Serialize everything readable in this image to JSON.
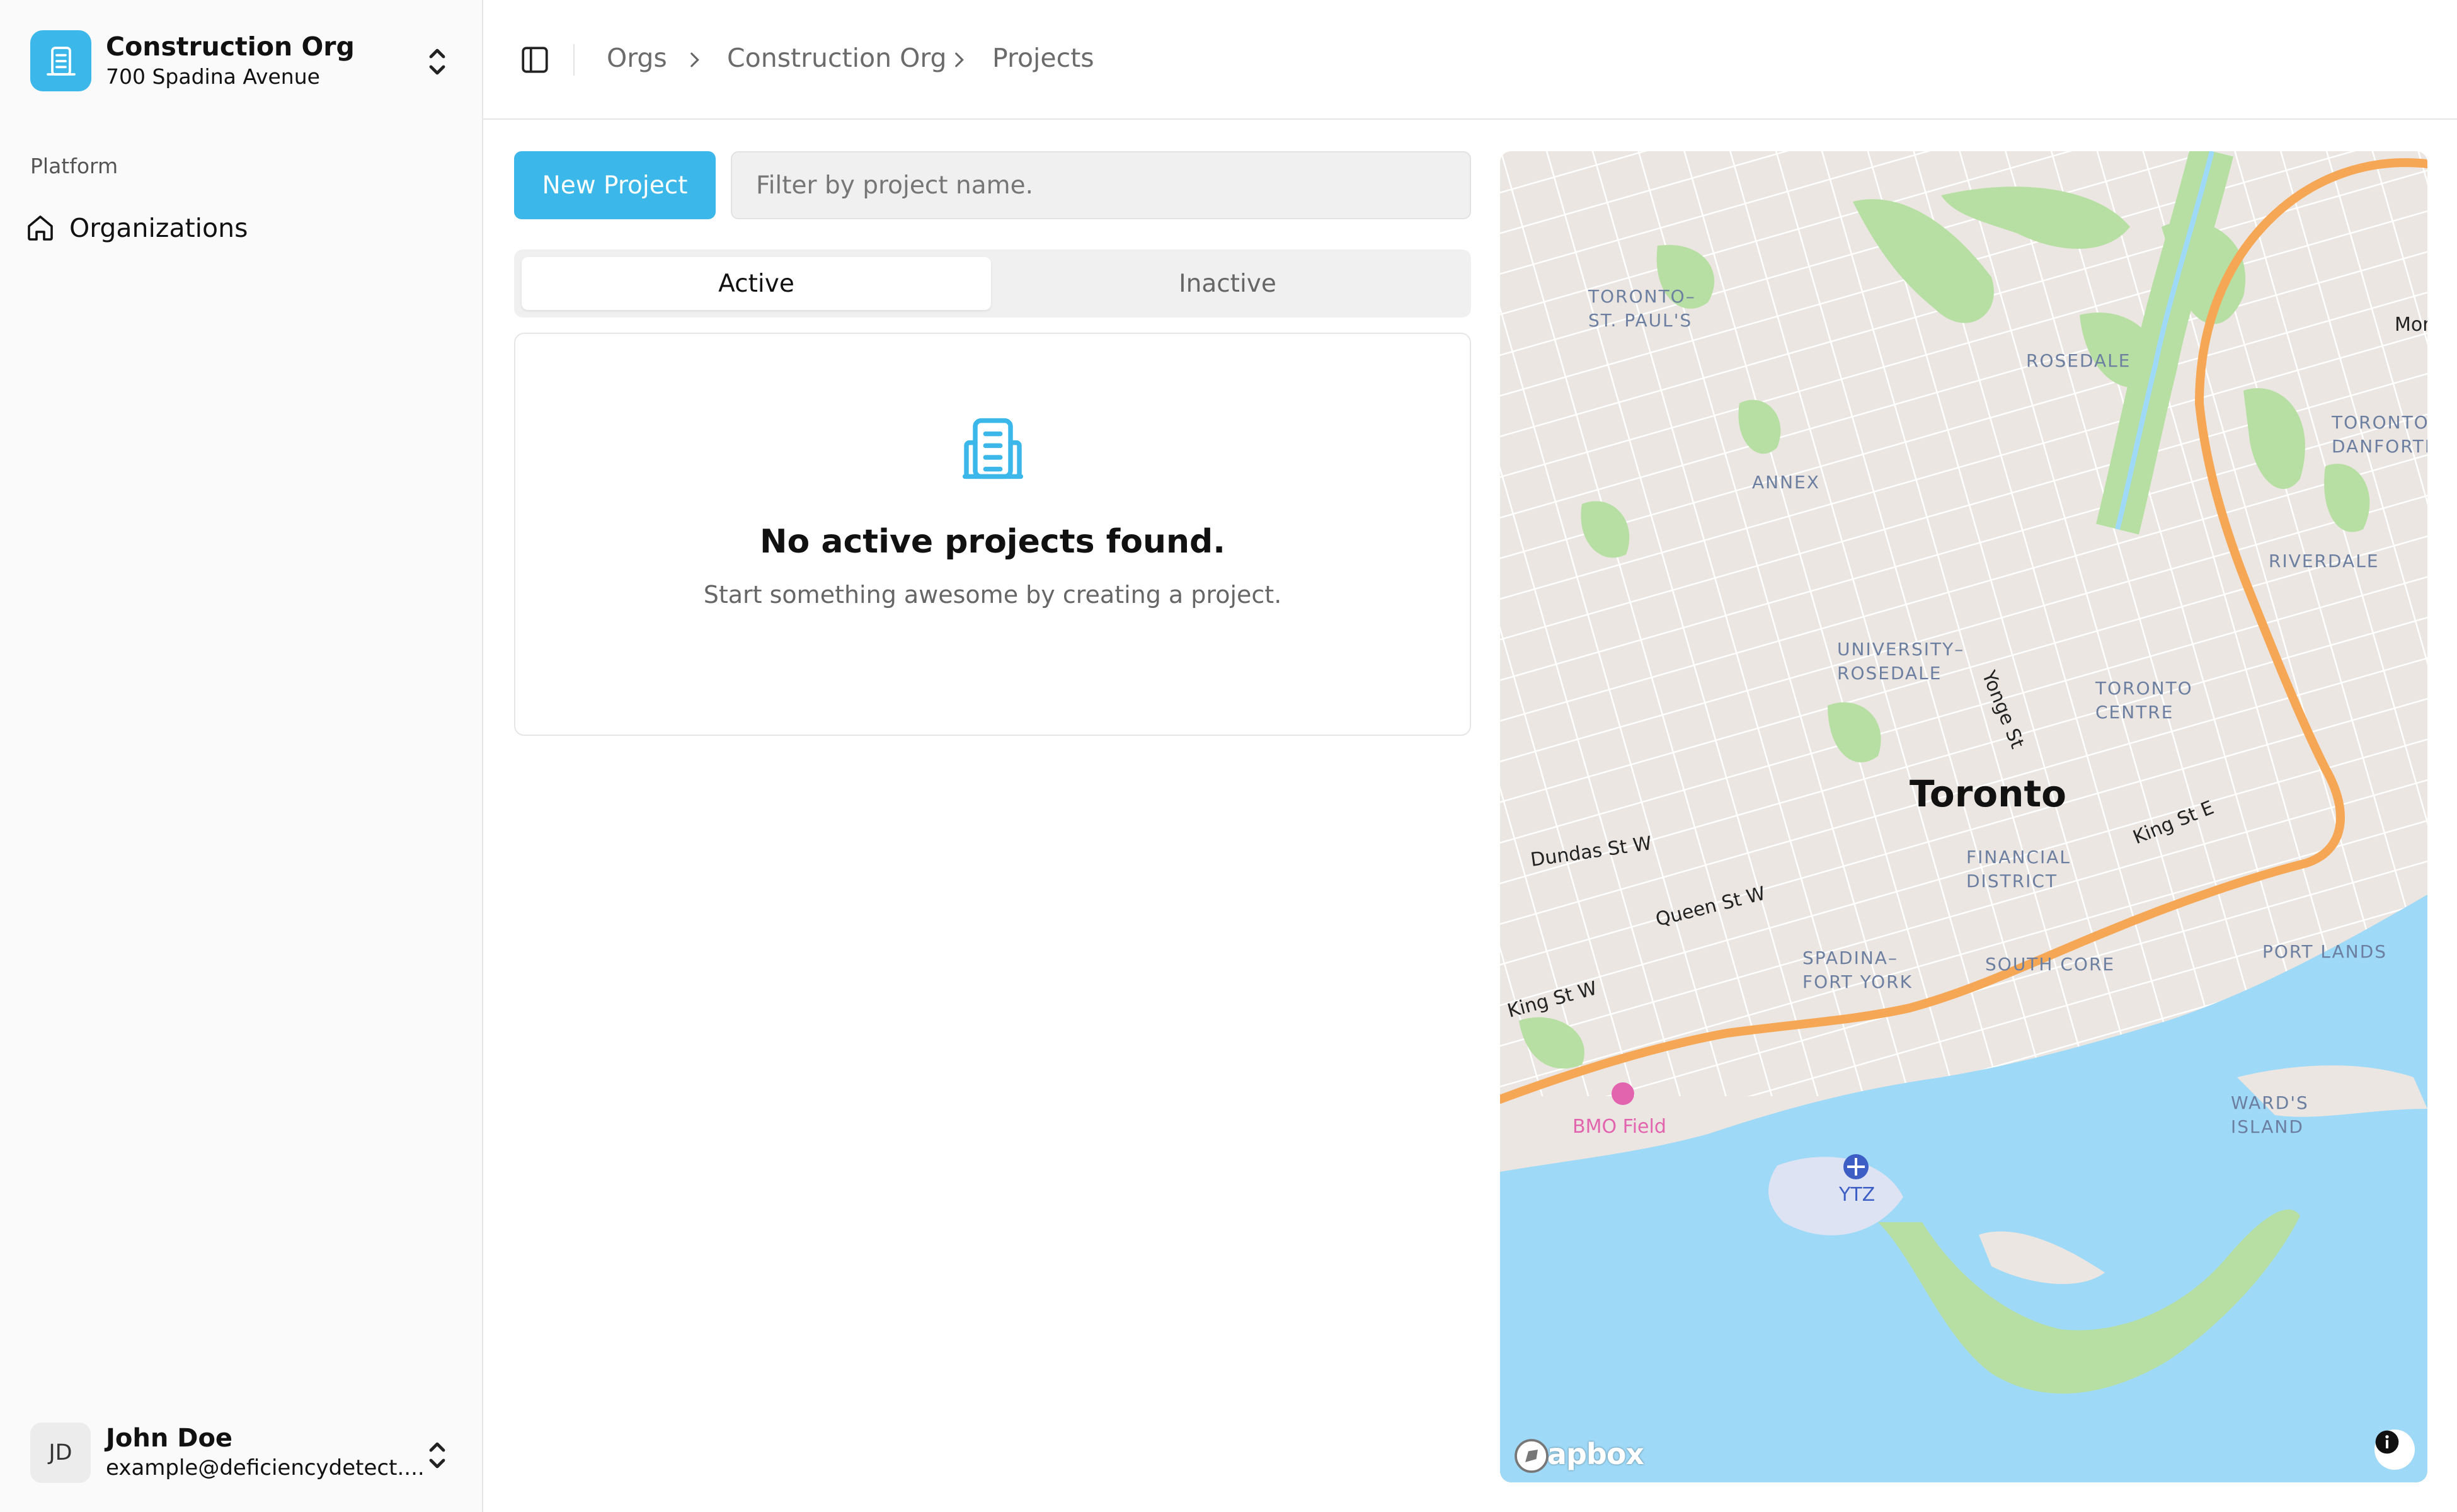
{
  "sidebar": {
    "org": {
      "name": "Construction Org",
      "address": "700 Spadina Avenue"
    },
    "section_label": "Platform",
    "nav": [
      {
        "label": "Organizations",
        "icon": "home-icon"
      }
    ],
    "user": {
      "initials": "JD",
      "name": "John Doe",
      "email": "example@deficiencydetect...."
    }
  },
  "header": {
    "breadcrumbs": [
      "Orgs",
      "Construction Org",
      "Projects"
    ]
  },
  "toolbar": {
    "new_project_label": "New Project",
    "filter_placeholder": "Filter by project name.",
    "filter_value": ""
  },
  "tabs": [
    {
      "label": "Active",
      "selected": true
    },
    {
      "label": "Inactive",
      "selected": false
    }
  ],
  "empty_state": {
    "icon": "building-icon",
    "title": "No active projects found.",
    "subtitle": "Start something awesome by creating a project."
  },
  "map": {
    "city_label": "Toronto",
    "neighbourhoods": {
      "stpauls": "TORONTO–\nST. PAUL'S",
      "rosedale": "ROSEDALE",
      "danforth": "TORONTO–\nDANFORTH",
      "annex": "ANNEX",
      "riverdale": "RIVERDALE",
      "university": "UNIVERSITY–\nROSEDALE",
      "centre": "TORONTO\nCENTRE",
      "financial": "FINANCIAL\nDISTRICT",
      "spadina": "SPADINA–\nFORT YORK",
      "southcore": "SOUTH CORE",
      "portlands": "PORT LANDS",
      "wards": "WARD'S\nISLAND"
    },
    "streets": {
      "yonge": "Yonge St",
      "dundas": "Dundas St W",
      "queen": "Queen St W",
      "king_w": "King St W",
      "king_e": "King St E",
      "morti": "Morti"
    },
    "pois": {
      "bmo": "BMO Field",
      "ytz": "YTZ"
    },
    "attribution": "mapbox",
    "colors": {
      "water": "#9ed9f7",
      "land": "#ebe6e1",
      "park": "#b7dfa3",
      "highway": "#f6a755"
    }
  },
  "theme": {
    "accent": "#3bb7ea"
  }
}
